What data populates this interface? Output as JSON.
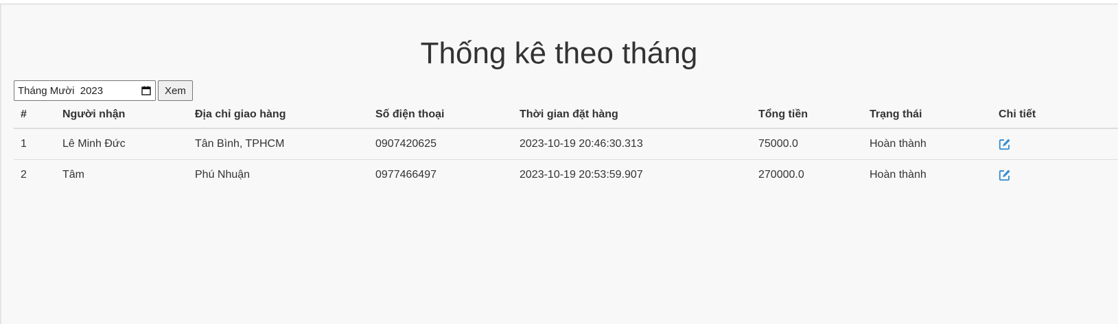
{
  "page": {
    "title": "Thống kê theo tháng"
  },
  "filter": {
    "month_value": "Tháng Mười  2023",
    "calendar_icon": "calendar-icon",
    "view_button_label": "Xem"
  },
  "table": {
    "headers": {
      "index": "#",
      "recipient": "Người nhận",
      "address": "Địa chỉ giao hàng",
      "phone": "Số điện thoại",
      "order_time": "Thời gian đặt hàng",
      "total": "Tổng tiền",
      "status": "Trạng thái",
      "details": "Chi tiết"
    },
    "rows": [
      {
        "index": "1",
        "recipient": "Lê Minh Đức",
        "address": "Tân Bình, TPHCM",
        "phone": "0907420625",
        "order_time": "2023-10-19 20:46:30.313",
        "total": "75000.0",
        "status": "Hoàn thành",
        "details_icon": "edit-icon"
      },
      {
        "index": "2",
        "recipient": "Tâm",
        "address": "Phú Nhuận",
        "phone": "0977466497",
        "order_time": "2023-10-19 20:53:59.907",
        "total": "270000.0",
        "status": "Hoàn thành",
        "details_icon": "edit-icon"
      }
    ]
  },
  "colors": {
    "background": "#f8f8f8",
    "text": "#333333",
    "edit_icon": "#3a8fd1",
    "row_border": "#dddddd"
  }
}
